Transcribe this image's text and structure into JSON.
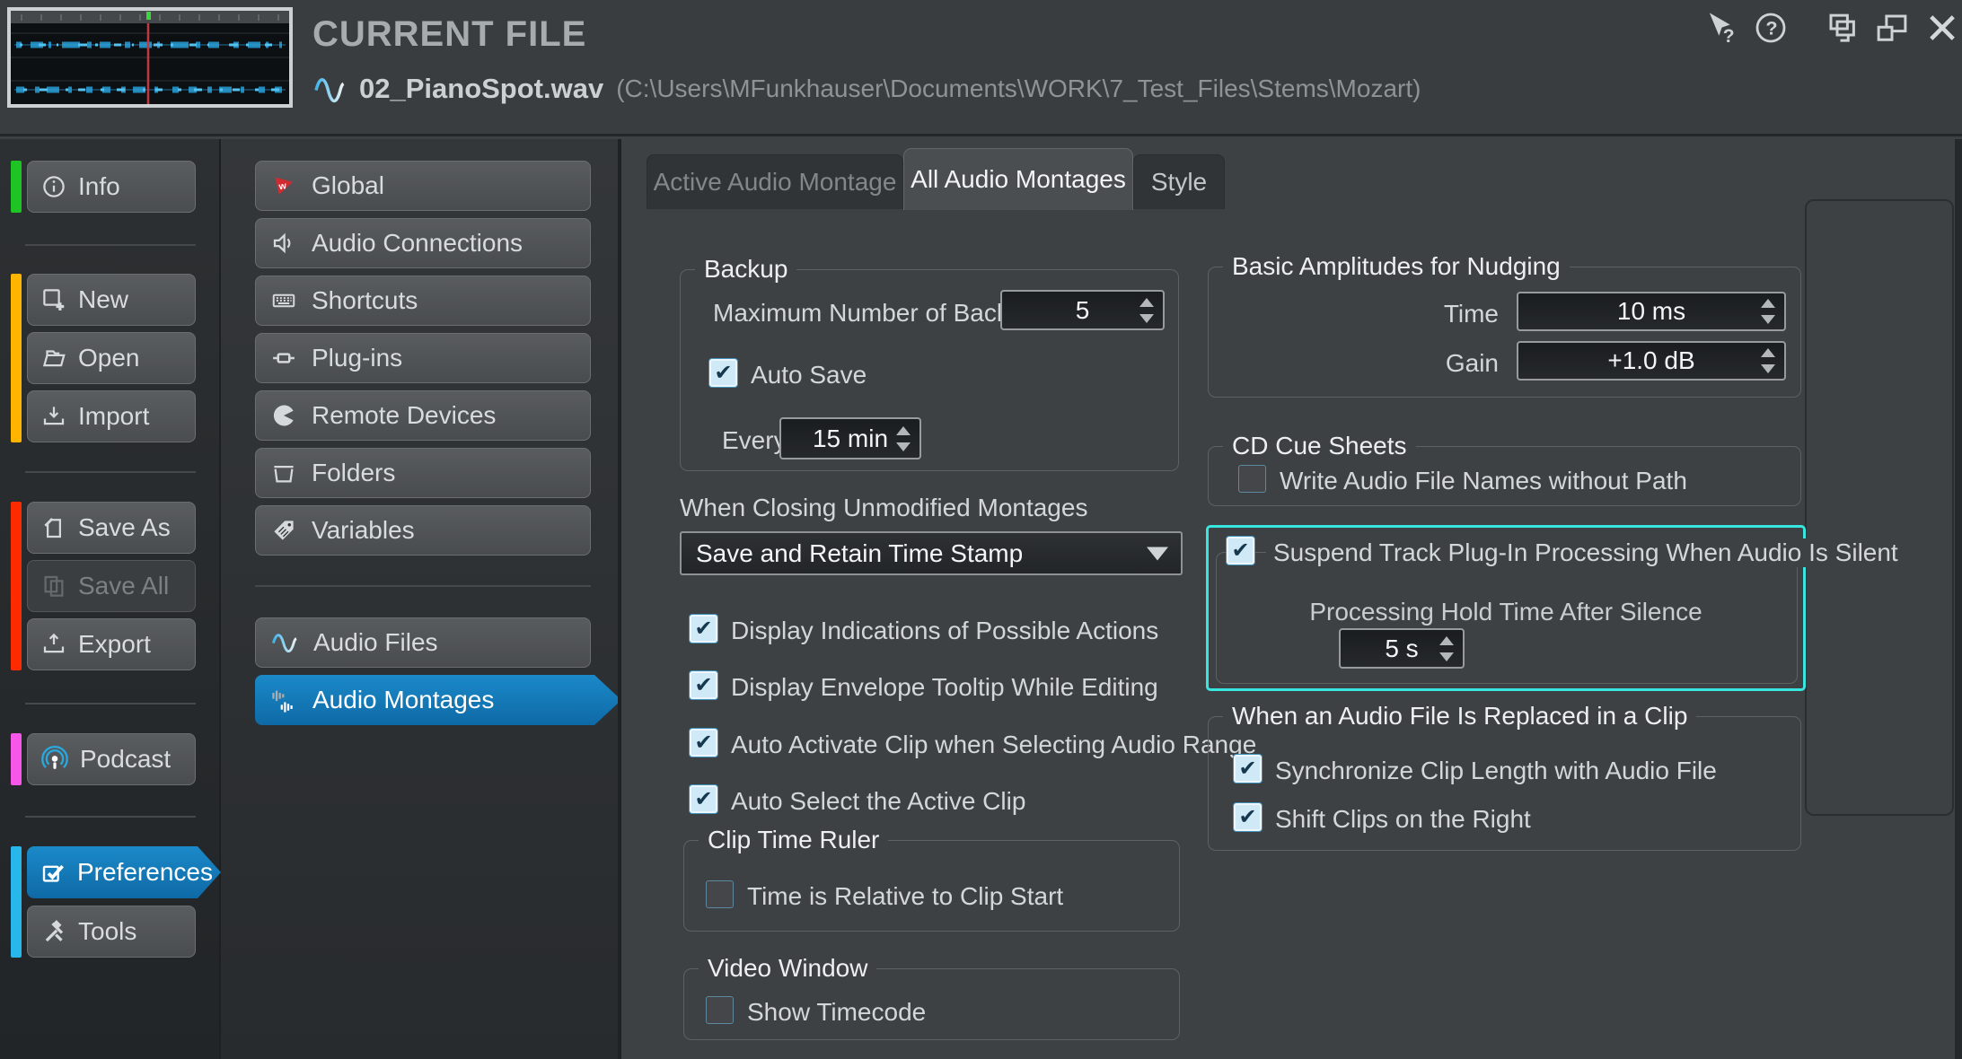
{
  "header": {
    "title": "CURRENT FILE",
    "file_name": "02_PianoSpot.wav",
    "file_path": "(C:\\Users\\MFunkhauser\\Documents\\WORK\\7_Test_Files\\Stems\\Mozart)"
  },
  "sidebar": {
    "info": "Info",
    "new": "New",
    "open": "Open",
    "import": "Import",
    "save_as": "Save As",
    "save_all": "Save All",
    "export": "Export",
    "podcast": "Podcast",
    "preferences": "Preferences",
    "tools": "Tools",
    "accent_colors": {
      "info": "#1dc424",
      "file": "#ffb400",
      "save": "#ff2b00",
      "podcast": "#f757e8",
      "settings": "#27b7ea"
    }
  },
  "categories": {
    "global": "Global",
    "audio_connections": "Audio Connections",
    "shortcuts": "Shortcuts",
    "plug_ins": "Plug-ins",
    "remote_devices": "Remote Devices",
    "folders": "Folders",
    "variables": "Variables",
    "audio_files": "Audio Files",
    "audio_montages": "Audio Montages"
  },
  "tabs": {
    "active": "Active Audio Montage",
    "all": "All Audio Montages",
    "style": "Style"
  },
  "backup": {
    "legend": "Backup",
    "max_label": "Maximum Number of Backups",
    "max_value": "5",
    "auto_save": {
      "label": "Auto Save",
      "checked": true
    },
    "every_label": "Every",
    "every_value": "15 min"
  },
  "closing": {
    "label": "When Closing Unmodified Montages",
    "value": "Save and Retain Time Stamp"
  },
  "montage_options": [
    {
      "label": "Display Indications of Possible Actions",
      "checked": true
    },
    {
      "label": "Display Envelope Tooltip While Editing",
      "checked": true
    },
    {
      "label": "Auto Activate Clip when Selecting Audio Range",
      "checked": true
    },
    {
      "label": "Auto Select the Active Clip",
      "checked": true
    }
  ],
  "clip_time_ruler": {
    "legend": "Clip Time Ruler",
    "option": {
      "label": "Time is Relative to Clip Start",
      "checked": false
    }
  },
  "video_window": {
    "legend": "Video Window",
    "option": {
      "label": "Show Timecode",
      "checked": false
    }
  },
  "nudging": {
    "legend": "Basic Amplitudes for Nudging",
    "time_label": "Time",
    "time_value": "10 ms",
    "gain_label": "Gain",
    "gain_value": "+1.0 dB"
  },
  "cd_cue_sheets": {
    "legend": "CD Cue Sheets",
    "option": {
      "label": "Write Audio File Names without Path",
      "checked": false
    }
  },
  "suspend": {
    "highlight_color": "#36e6df",
    "option": {
      "label": "Suspend Track Plug-In Processing When Audio Is Silent",
      "checked": true
    },
    "hold_label": "Processing Hold Time After Silence",
    "hold_value": "5 s"
  },
  "replace": {
    "legend": "When an Audio File Is Replaced in a Clip",
    "options": [
      {
        "label": "Synchronize Clip Length with Audio File",
        "checked": true
      },
      {
        "label": "Shift Clips on the Right",
        "checked": true
      }
    ]
  }
}
